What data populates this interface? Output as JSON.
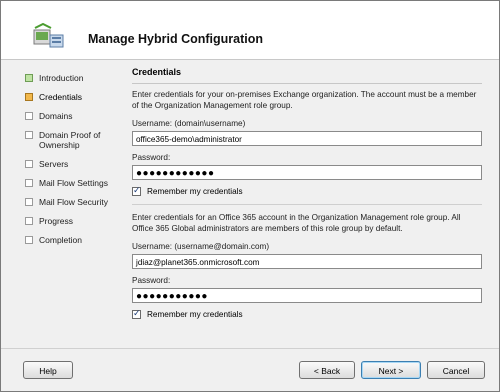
{
  "window": {
    "title": "Manage Hybrid Configuration"
  },
  "steps": [
    {
      "label": "Introduction",
      "state": "done"
    },
    {
      "label": "Credentials",
      "state": "current"
    },
    {
      "label": "Domains",
      "state": "pending"
    },
    {
      "label": "Domain Proof of Ownership",
      "state": "pending"
    },
    {
      "label": "Servers",
      "state": "pending"
    },
    {
      "label": "Mail Flow Settings",
      "state": "pending"
    },
    {
      "label": "Mail Flow Security",
      "state": "pending"
    },
    {
      "label": "Progress",
      "state": "pending"
    },
    {
      "label": "Completion",
      "state": "pending"
    }
  ],
  "credentials": {
    "title": "Credentials",
    "onprem_intro": "Enter credentials for your on-premises Exchange organization. The account must be a member of the Organization Management role group.",
    "onprem_username_label": "Username: (domain\\username)",
    "onprem_username_value": "office365-demo\\administrator",
    "onprem_password_label": "Password:",
    "onprem_password_value": "●●●●●●●●●●●●",
    "onprem_remember_label": "Remember my credentials",
    "cloud_intro": "Enter credentials for an Office 365 account in the Organization Management role group. All Office 365 Global administrators are members of this role group by default.",
    "cloud_username_label": "Username: (username@domain.com)",
    "cloud_username_value": "jdiaz@planet365.onmicrosoft.com",
    "cloud_password_label": "Password:",
    "cloud_password_value": "●●●●●●●●●●●",
    "cloud_remember_label": "Remember my credentials"
  },
  "buttons": {
    "help": "Help",
    "back": "< Back",
    "next": "Next >",
    "cancel": "Cancel"
  }
}
